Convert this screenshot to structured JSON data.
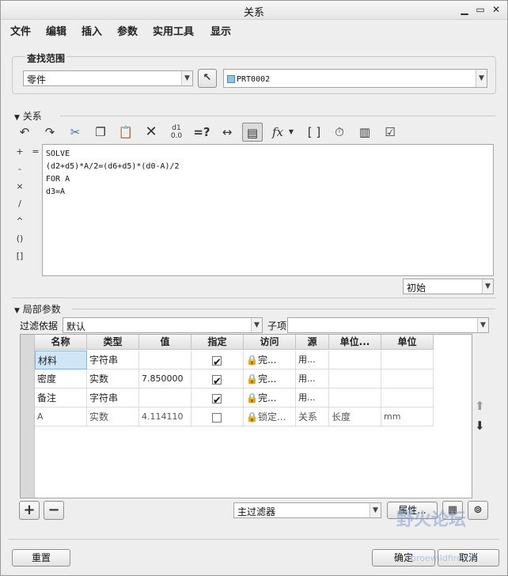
{
  "window": {
    "title": "关系",
    "min_icon": "minimize-icon",
    "max_icon": "maximize-icon",
    "close_icon": "close-icon"
  },
  "menu": [
    "文件",
    "编辑",
    "插入",
    "参数",
    "实用工具",
    "显示"
  ],
  "lookup": {
    "title": "查找范围",
    "scope_value": "零件",
    "model_value": "PRT0002"
  },
  "relations": {
    "title": "关系",
    "lines": [
      "SOLVE",
      "(d2+d5)*A/2=(d6+d5)*(d0-A)/2",
      "FOR A",
      "d3=A"
    ],
    "operators": [
      "+",
      "-",
      "×",
      "/",
      "^",
      "()",
      "[]"
    ],
    "equals": "=",
    "mode_value": "初始",
    "toolbar_icons": [
      "undo-icon",
      "redo-icon",
      "cut-icon",
      "copy-icon",
      "paste-icon",
      "delete-icon",
      "toggle-display-icon",
      "evaluate-icon",
      "dimension-icon",
      "sort-icon",
      "function-icon",
      "brackets-icon",
      "timer-icon",
      "verify-icon",
      "check-icon"
    ],
    "dim_display_top": "d1",
    "dim_display_bottom": "0.0"
  },
  "local_params": {
    "title": "局部参数",
    "filter_label": "过滤依据",
    "filter_value": "默认",
    "child_label": "子项",
    "child_value": "",
    "columns": [
      "名称",
      "类型",
      "值",
      "指定",
      "访问",
      "源",
      "单位...",
      "单位"
    ],
    "rows": [
      {
        "name": "材料",
        "type": "字符串",
        "value": "",
        "designate": true,
        "access": "完...",
        "source": "用...",
        "unit_type": "",
        "unit": ""
      },
      {
        "name": "密度",
        "type": "实数",
        "value": "7.850000",
        "designate": true,
        "access": "完...",
        "source": "用...",
        "unit_type": "",
        "unit": ""
      },
      {
        "name": "备注",
        "type": "字符串",
        "value": "",
        "designate": true,
        "access": "完...",
        "source": "用...",
        "unit_type": "",
        "unit": ""
      },
      {
        "name": "A",
        "type": "实数",
        "value": "4.114110",
        "designate": false,
        "access": "锁定...",
        "source": "关系",
        "unit_type": "长度",
        "unit": "mm"
      }
    ],
    "main_filter_value": "主过滤器",
    "properties_label": "属性..."
  },
  "footer": {
    "reset_label": "重置",
    "ok_label": "确定",
    "cancel_label": "取消"
  },
  "watermark": {
    "text": "野火论坛",
    "url": "proewildfire.cn"
  }
}
